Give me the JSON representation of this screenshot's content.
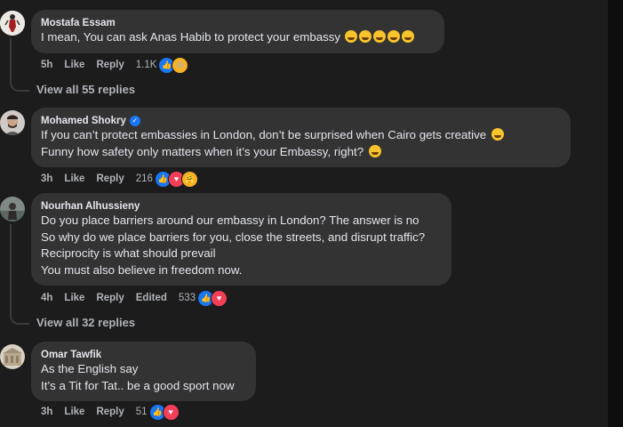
{
  "comments": [
    {
      "author": "Mostafa Essam",
      "verified": false,
      "lines": [
        "I mean, You can ask Anas Habib to protect your embassy"
      ],
      "emoji_trail": [
        "haha-emoji",
        "haha-emoji",
        "haha-emoji",
        "haha-emoji",
        "haha-emoji"
      ],
      "time": "5h",
      "like_label": "Like",
      "reply_label": "Reply",
      "reaction_count": "1.1K",
      "reactions": [
        "like",
        "haha"
      ]
    },
    {
      "author": "Mohamed Shokry",
      "verified": true,
      "lines": [
        "If you can’t protect embassies in London, don’t be surprised when Cairo gets creative",
        "Funny how safety only matters when it’s your Embassy, right?"
      ],
      "time": "3h",
      "like_label": "Like",
      "reply_label": "Reply",
      "reaction_count": "216",
      "reactions": [
        "like",
        "love",
        "care"
      ]
    },
    {
      "author": "Nourhan Alhussieny",
      "verified": false,
      "lines": [
        "Do you place barriers around our embassy in London? The answer is no",
        "So why do we place barriers for you, close the streets, and disrupt traffic?",
        "Reciprocity is what should prevail",
        "You must also believe in freedom now."
      ],
      "time": "4h",
      "like_label": "Like",
      "reply_label": "Reply",
      "edited_label": "Edited",
      "reaction_count": "533",
      "reactions": [
        "like",
        "love"
      ]
    },
    {
      "author": "Omar Tawfik",
      "verified": false,
      "lines": [
        "As the English say",
        "It’s a Tit for Tat.. be a good sport now"
      ],
      "time": "3h",
      "like_label": "Like",
      "reply_label": "Reply",
      "reaction_count": "51",
      "reactions": [
        "like",
        "love"
      ]
    }
  ],
  "view_replies": [
    "View all 55 replies",
    "View all 32 replies"
  ],
  "colors": {
    "background": "#1c1c1d",
    "bubble": "#333334",
    "text": "#e4e6eb",
    "muted": "#b0b3b8",
    "like_blue": "#1877f2",
    "love_red": "#f33e58",
    "emoji_yellow": "#f7b125"
  }
}
